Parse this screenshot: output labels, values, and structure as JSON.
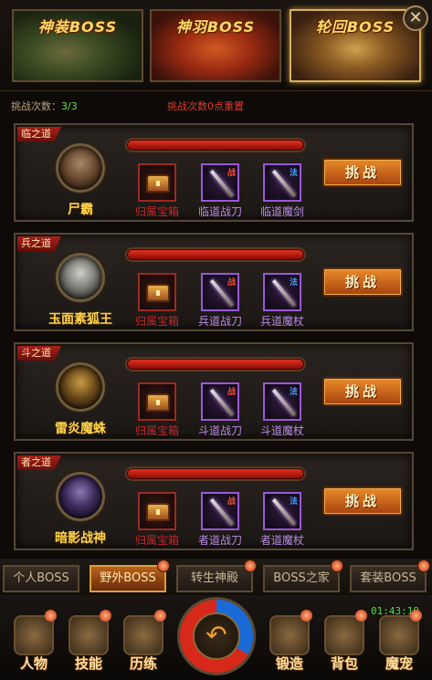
{
  "top_tabs": [
    {
      "title": "神装BOSS",
      "active": false
    },
    {
      "title": "神羽BOSS",
      "active": false
    },
    {
      "title": "轮回BOSS",
      "active": true
    }
  ],
  "close_label": "✕",
  "challenge": {
    "count_label": "挑战次数：",
    "count_value": "3/3",
    "reset_note": "挑战次数0点重置"
  },
  "bosses": [
    {
      "dao": "临之道",
      "name": "尸霸",
      "rewards": [
        "归属宝箱",
        "临道战刀",
        "临道魔剑"
      ],
      "challenge_label": "挑战"
    },
    {
      "dao": "兵之道",
      "name": "玉面素狐王",
      "rewards": [
        "归属宝箱",
        "兵道战刀",
        "兵道魔杖"
      ],
      "challenge_label": "挑战"
    },
    {
      "dao": "斗之道",
      "name": "雷炎魔蛛",
      "rewards": [
        "归属宝箱",
        "斗道战刀",
        "斗道魔杖"
      ],
      "challenge_label": "挑战"
    },
    {
      "dao": "者之道",
      "name": "暗影战神",
      "rewards": [
        "归属宝箱",
        "者道战刀",
        "者道魔杖"
      ],
      "challenge_label": "挑战"
    }
  ],
  "weapon_tags": {
    "war": "战",
    "mage": "法"
  },
  "bottom_tabs": [
    "个人BOSS",
    "野外BOSS",
    "转生神殿",
    "BOSS之家",
    "套装BOSS"
  ],
  "active_bottom_tab": "野外BOSS",
  "clock": "01:43:19",
  "menu": [
    "人物",
    "技能",
    "历练",
    "锻造",
    "背包",
    "魔宠"
  ],
  "center_icon": "return-arrow-icon",
  "colors": {
    "accent": "#e88a2a",
    "hp": "#e23020",
    "epic": "#9a58d8",
    "clock": "#4ae04a"
  }
}
